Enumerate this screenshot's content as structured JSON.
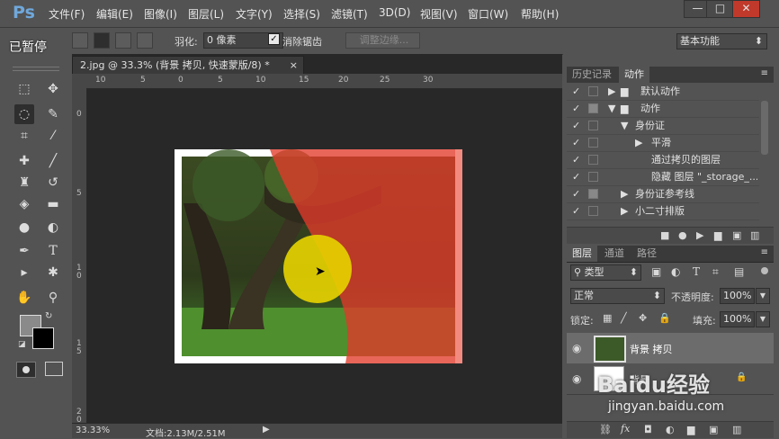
{
  "app": {
    "logo": "Ps"
  },
  "menu": [
    "文件(F)",
    "编辑(E)",
    "图像(I)",
    "图层(L)",
    "文字(Y)",
    "选择(S)",
    "滤镜(T)",
    "3D(D)",
    "视图(V)",
    "窗口(W)",
    "帮助(H)"
  ],
  "window_controls": {
    "minimize": "—",
    "restore": "□",
    "close": "✕"
  },
  "overlay_status": "已暂停",
  "options": {
    "feather_label": "羽化:",
    "feather_value": "0 像素",
    "antialias_label": "消除锯齿",
    "refine_edge": "调整边缘...",
    "workspace": "基本功能"
  },
  "document": {
    "tab_title": "2.jpg @ 33.3% (背景 拷贝, 快速蒙版/8) *",
    "ruler_h": [
      "10",
      "5",
      "0",
      "5",
      "10",
      "15",
      "20",
      "25",
      "30"
    ],
    "ruler_v": [
      "0",
      "5",
      "1\n0",
      "1\n5",
      "2\n0"
    ],
    "zoom": "33.33%",
    "doc_info": "文档:2.13M/2.51M"
  },
  "panels": {
    "history_tab": "历史记录",
    "actions_tab": "动作",
    "actions": [
      {
        "label": "默认动作",
        "indent": 0,
        "arrow": "▶",
        "folder": true
      },
      {
        "label": "动作",
        "indent": 0,
        "arrow": "▼",
        "folder": true
      },
      {
        "label": "身份证",
        "indent": 1,
        "arrow": "▼",
        "folder": false
      },
      {
        "label": "平滑",
        "indent": 2,
        "arrow": "▶",
        "folder": false
      },
      {
        "label": "通过拷贝的图层",
        "indent": 3,
        "arrow": "",
        "folder": false
      },
      {
        "label": "隐藏 图层 \"_storage_...",
        "indent": 3,
        "arrow": "",
        "folder": false
      },
      {
        "label": "身份证参考线",
        "indent": 1,
        "arrow": "▶",
        "folder": false
      },
      {
        "label": "小二寸排版",
        "indent": 1,
        "arrow": "▶",
        "folder": false
      }
    ],
    "layers_tab": "图层",
    "channels_tab": "通道",
    "paths_tab": "路径",
    "filter_kind": "类型",
    "blend_mode": "正常",
    "opacity_label": "不透明度:",
    "opacity_value": "100%",
    "lock_label": "锁定:",
    "fill_label": "填充:",
    "fill_value": "100%",
    "layers": [
      {
        "name": "背景 拷贝",
        "selected": true
      },
      {
        "name": "背景",
        "selected": false
      }
    ]
  },
  "watermark": {
    "brand": "Baidu经验",
    "url": "jingyan.baidu.com"
  }
}
